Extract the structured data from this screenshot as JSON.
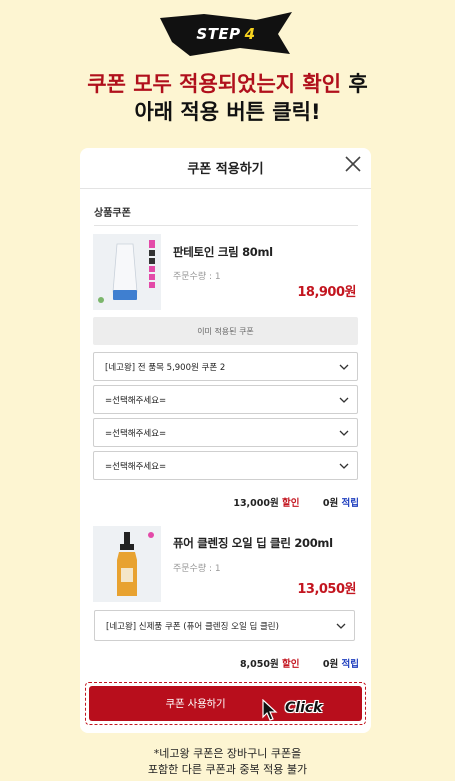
{
  "step": {
    "label": "STEP",
    "number": "4"
  },
  "headline": {
    "line1_red": "쿠폰 모두 적용되었는지 확인",
    "line1_rest": " 후",
    "line2": "아래 적용 버튼 클릭!"
  },
  "modal": {
    "title": "쿠폰 적용하기",
    "section_label": "상품쿠폰",
    "products": [
      {
        "name": "판테토인 크림 80ml",
        "qty": "주문수량 : 1",
        "price": "18,900원",
        "applied_note": "이미 적용된 쿠폰",
        "selects": [
          "[네고왕] 전 품목 5,900원 쿠폰 2",
          "=선택해주세요=",
          "=선택해주세요=",
          "=선택해주세요="
        ],
        "discount_amount": "13,000원",
        "discount_label": "할인",
        "earn_amount": "0원",
        "earn_label": "적립"
      },
      {
        "name": "퓨어 클렌징 오일 딥 클린 200ml",
        "qty": "주문수량 : 1",
        "price": "13,050원",
        "selects": [
          "[네고왕] 신제품 쿠폰 (퓨어 클렌징 오일 딥 클린)"
        ],
        "discount_amount": "8,050원",
        "discount_label": "할인",
        "earn_amount": "0원",
        "earn_label": "적립"
      }
    ],
    "apply_button": "쿠폰 사용하기",
    "click_label": "Click"
  },
  "footnote": {
    "line1": "*네고왕 쿠폰은 장바구니 쿠폰을",
    "line2": "포함한 다른 쿠폰과 중복 적용 불가"
  },
  "colors": {
    "background": "#fdf5d2",
    "accent_red": "#b80e1c",
    "earn_blue": "#1f3fbf"
  }
}
